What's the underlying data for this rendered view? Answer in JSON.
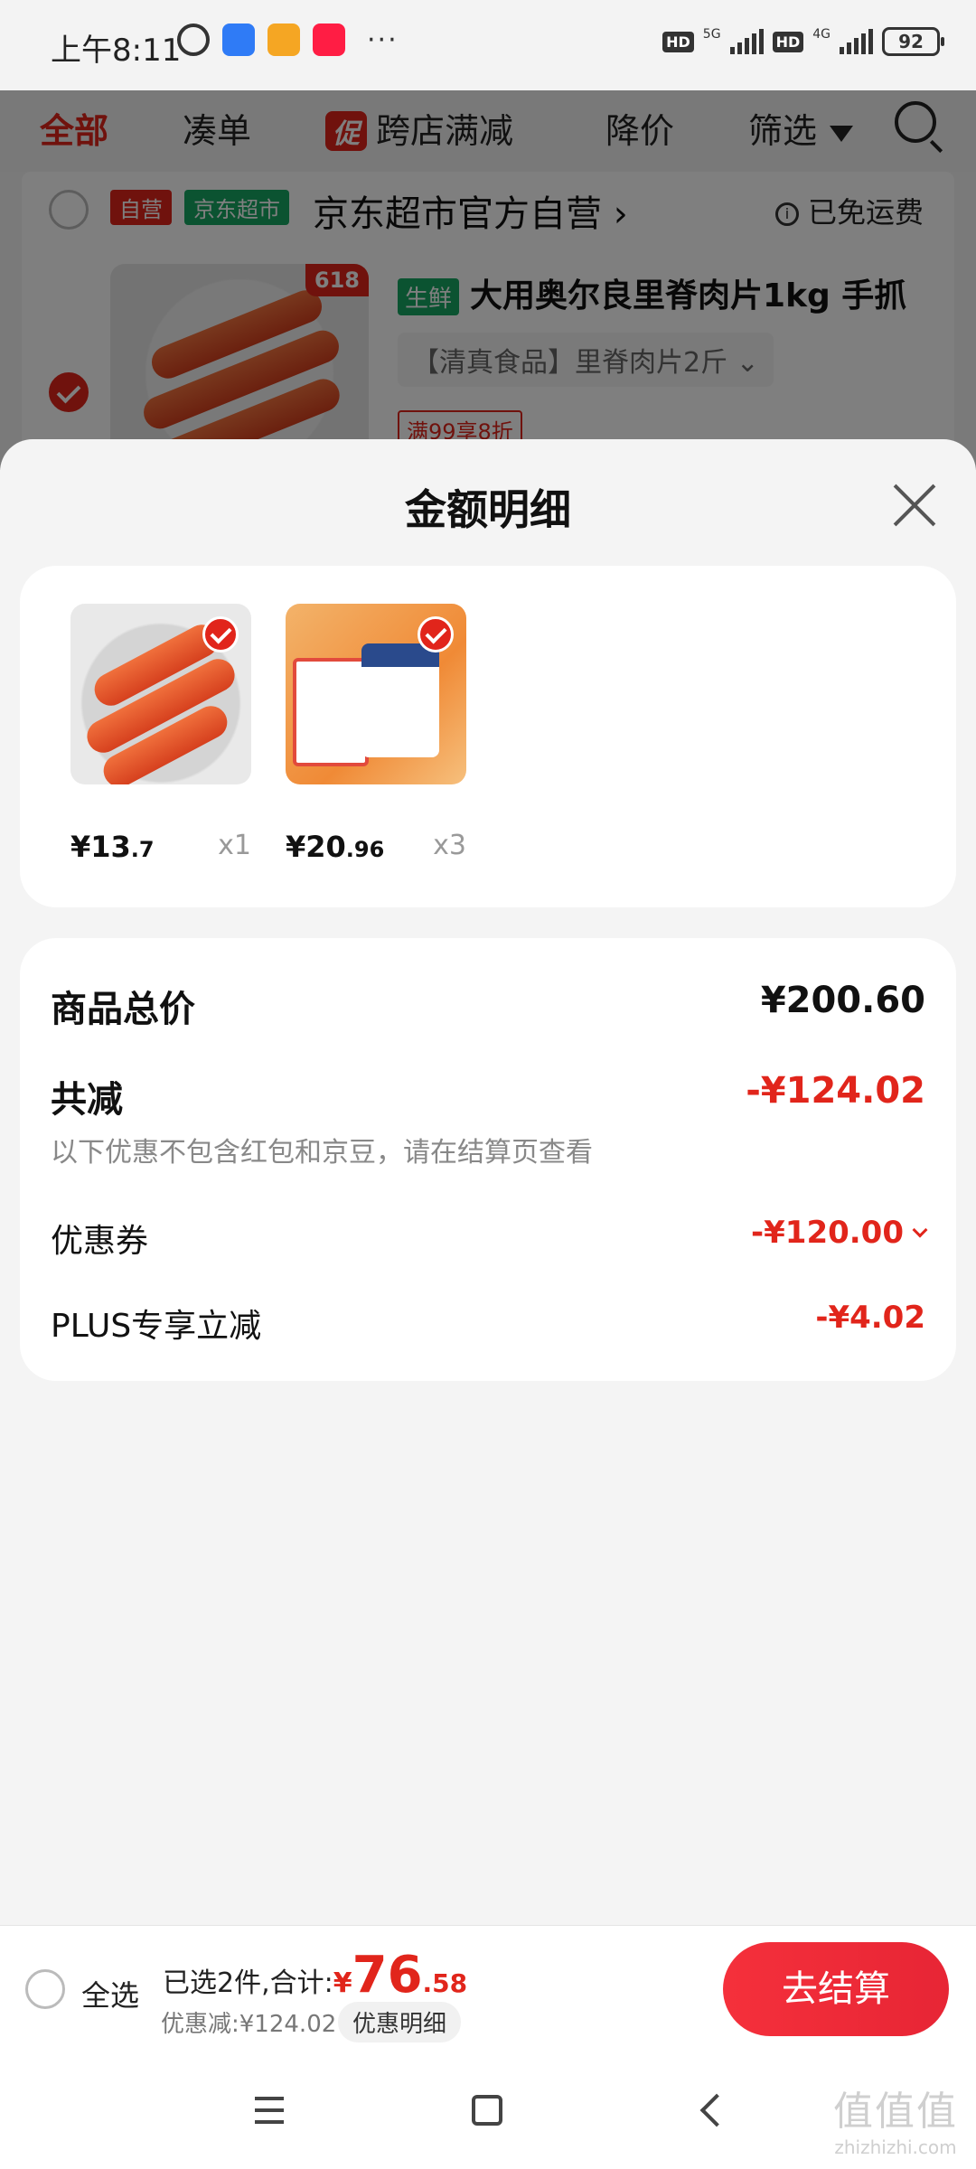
{
  "status_bar": {
    "time": "上午8:11",
    "app_icons": [
      "alarm-icon",
      "baidu-app-icon",
      "618-app-icon",
      "tmall-app-icon"
    ],
    "more": "···",
    "network": {
      "hd1": "HD",
      "label1": "5G",
      "hd2": "HD",
      "label2": "4G"
    },
    "battery": "92"
  },
  "tabs": {
    "all": "全部",
    "bundle": "凑单",
    "promo_badge": "促",
    "cross_store": "跨店满减",
    "price_drop": "降价",
    "filter": "筛选"
  },
  "store": {
    "self_run_tag": "自营",
    "supermarket_tag": "京东超市",
    "name": "京东超市官方自营 ›",
    "shipping": "已免运费",
    "product": {
      "tag_618": "618",
      "fresh_tag": "生鲜",
      "title": "大用奥尔良里脊肉片1kg 手抓",
      "spec": "【清真食品】里脊肉片2斤 ⌄",
      "promo": "满99享8折"
    }
  },
  "sheet": {
    "title": "金额明细",
    "items": [
      {
        "price_int": "¥13",
        "price_dec": ".7",
        "qty": "x1",
        "image": "orleans-chicken-skewers"
      },
      {
        "price_int": "¥20",
        "price_dec": ".96",
        "qty": "x3",
        "image": "baxi-mango-yogurt-drink"
      }
    ],
    "summary": {
      "total_label": "商品总价",
      "total_value": "¥200.60",
      "reduce_label": "共减",
      "reduce_value": "-¥124.02",
      "note": "以下优惠不包含红包和京豆，请在结算页查看",
      "coupon_label": "优惠券",
      "coupon_value": "-¥120.00",
      "plus_label": "PLUS专享立减",
      "plus_value": "-¥4.02"
    }
  },
  "action_bar": {
    "select_all": "全选",
    "selected_text": "已选2件,合计:",
    "total_yen": "¥",
    "total_int": "76",
    "total_dec": ".58",
    "discount_text": "优惠减:¥124.02",
    "detail_chip": "优惠明细",
    "checkout": "去结算"
  },
  "watermark": {
    "glyphs": "值值值",
    "domain": "zhizhizhi.com"
  },
  "colors": {
    "accent": "#e1251b",
    "green": "#17a662",
    "sheet_bg": "#f4f4f4"
  }
}
